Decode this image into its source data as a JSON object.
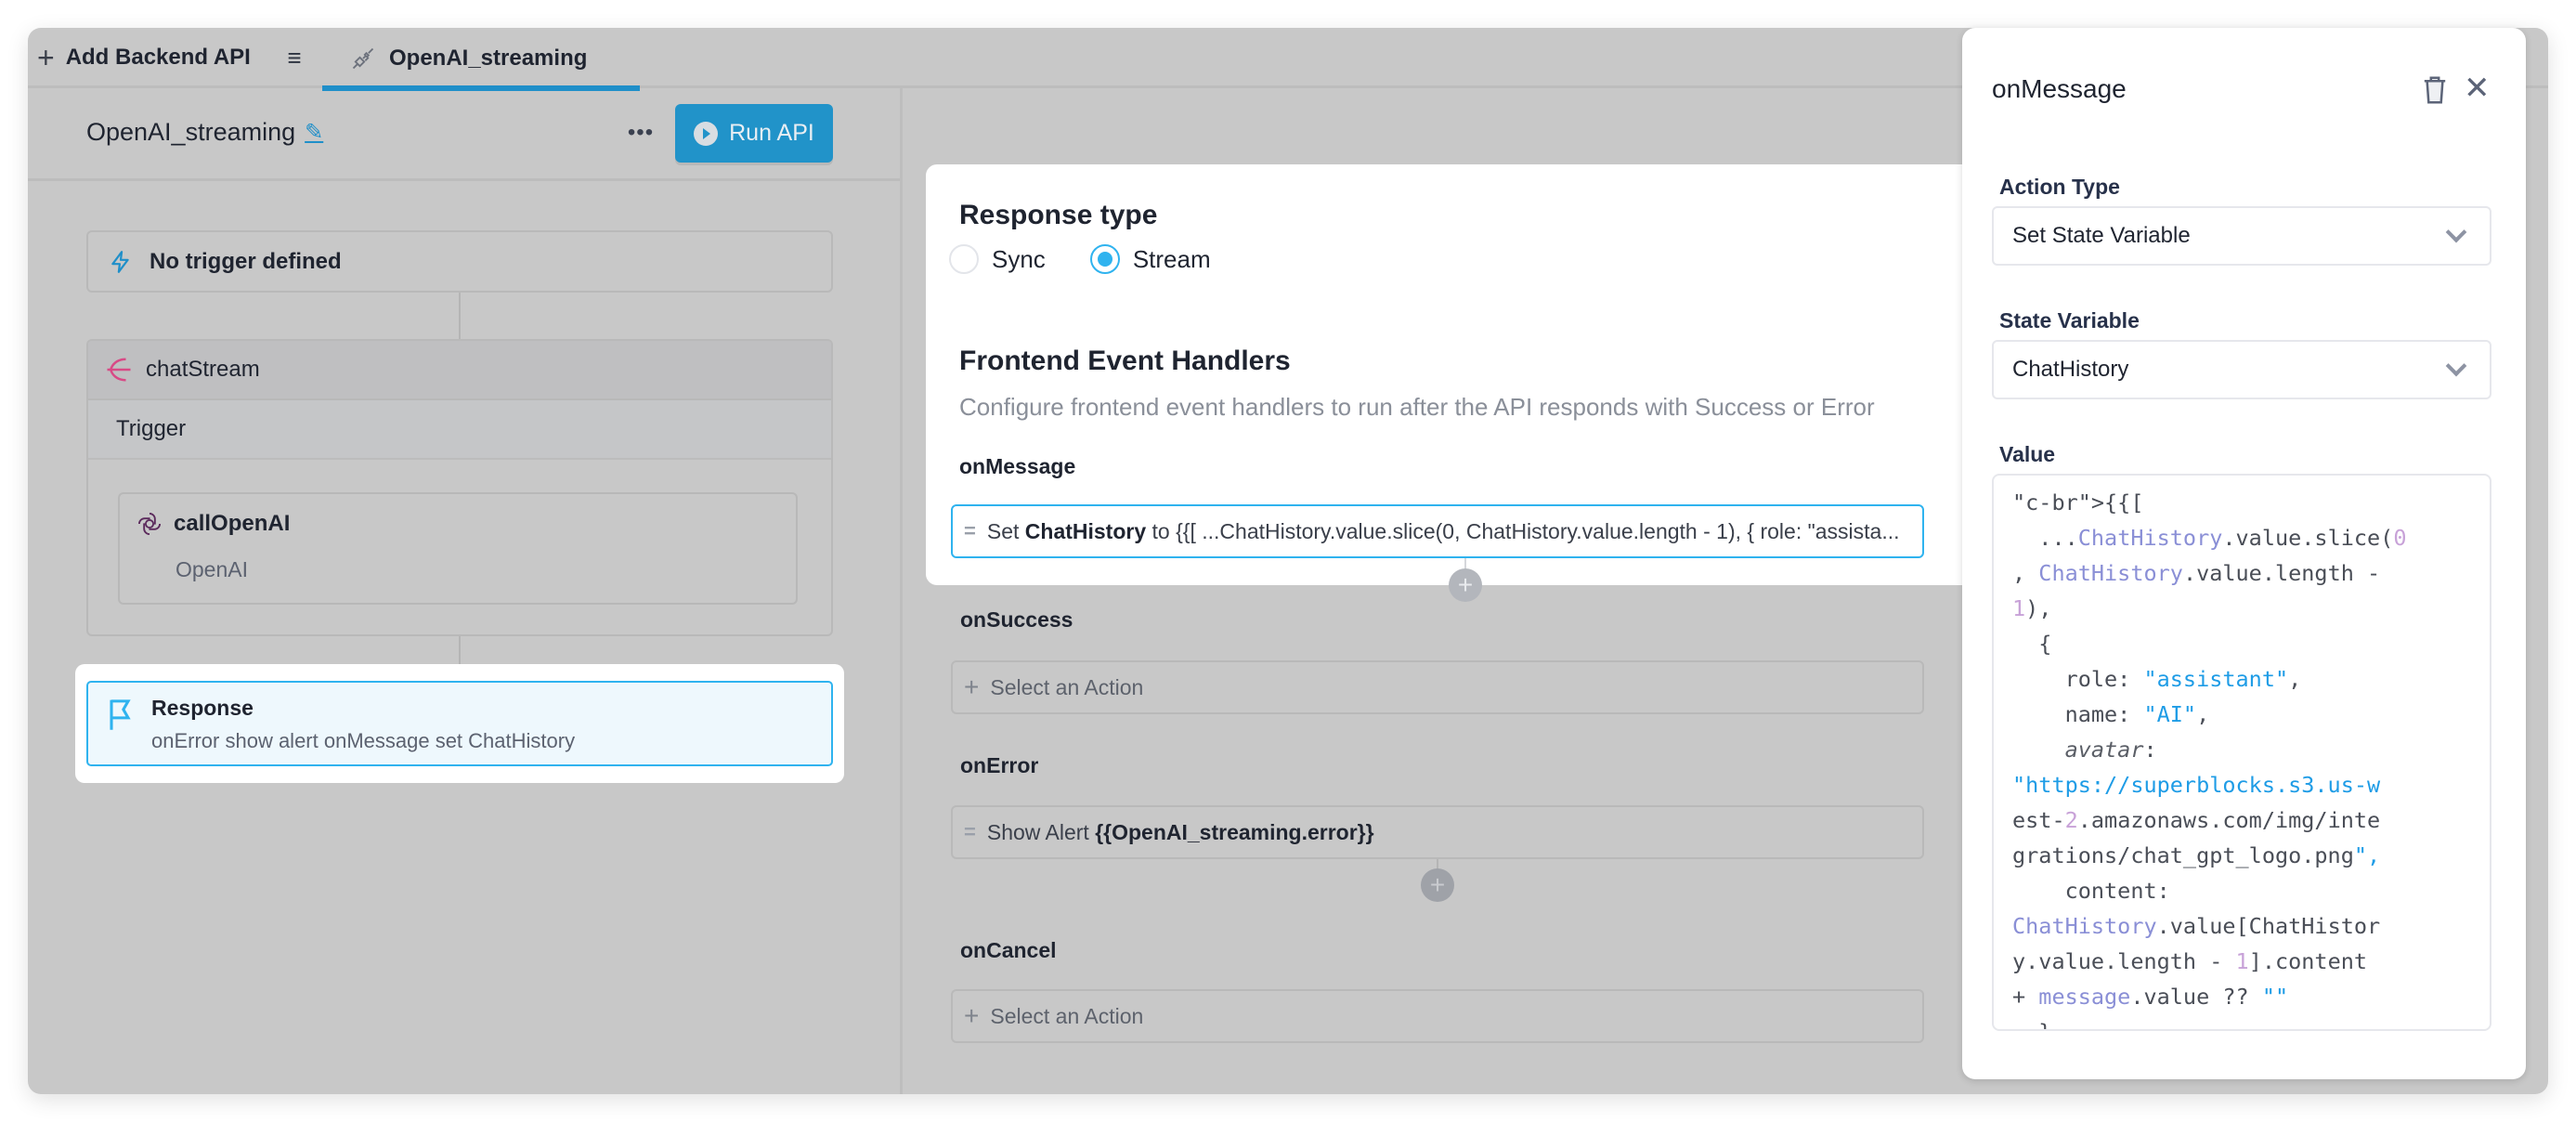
{
  "tabbar": {
    "add_label": "Add Backend API",
    "active_tab": "OpenAI_streaming"
  },
  "left": {
    "api_name": "OpenAI_streaming",
    "more_label": "•••",
    "run_label": "Run API",
    "trigger_label": "No trigger defined",
    "stream_block": {
      "name": "chatStream",
      "trigger_label": "Trigger",
      "step": {
        "name": "callOpenAI",
        "integration": "OpenAI"
      }
    },
    "response": {
      "title": "Response",
      "summary": "onError show alert onMessage set ChatHistory"
    }
  },
  "middle": {
    "response_type_heading": "Response type",
    "response_types": [
      {
        "label": "Sync",
        "selected": false
      },
      {
        "label": "Stream",
        "selected": true
      }
    ],
    "handlers_heading": "Frontend Event Handlers",
    "handlers_desc": "Configure frontend event handlers to run after the API responds with Success or Error",
    "handlers": {
      "onMessage": {
        "label": "onMessage",
        "action_prefix": "Set",
        "action_target": "ChatHistory",
        "action_suffix": "to {{[ ...ChatHistory.value.slice(0, ChatHistory.value.length - 1), { role: \"assista..."
      },
      "onSuccess": {
        "label": "onSuccess",
        "placeholder": "Select an Action"
      },
      "onError": {
        "label": "onError",
        "action_prefix": "Show Alert",
        "action_target": "{{OpenAI_streaming.error}}"
      },
      "onCancel": {
        "label": "onCancel",
        "placeholder": "Select an Action"
      }
    }
  },
  "panel": {
    "title": "onMessage",
    "action_type_label": "Action Type",
    "action_type_value": "Set State Variable",
    "state_variable_label": "State Variable",
    "state_variable_value": "ChatHistory",
    "value_label": "Value",
    "value_code": "{{[\n  ...ChatHistory.value.slice(0, ChatHistory.value.length - 1),\n  {\n    role: \"assistant\",\n    name: \"AI\",\n    avatar: \"https://superblocks.s3.us-west-2.amazonaws.com/img/integrations/chat_gpt_logo.png\",\n    content: ChatHistory.value[ChatHistory.value.length - 1].content + message.value ?? \"\"\n  }\n]}}"
  },
  "colors": {
    "accent": "#1f8fc9",
    "selection": "#2fb3ef",
    "stream_icon": "#d84a86",
    "overlay_bg": "#c8c8c8"
  },
  "icons": {
    "add": "plus-icon",
    "menu": "hamburger-icon",
    "tab": "plug-icon",
    "edit": "pencil-icon",
    "run": "play-circle-icon",
    "trigger": "lightning-icon",
    "stream": "stream-fork-icon",
    "step": "openai-icon",
    "response": "flag-icon",
    "drag": "drag-handle-icon",
    "delete": "trash-icon",
    "close": "close-icon",
    "dropdown": "chevron-down-icon"
  }
}
